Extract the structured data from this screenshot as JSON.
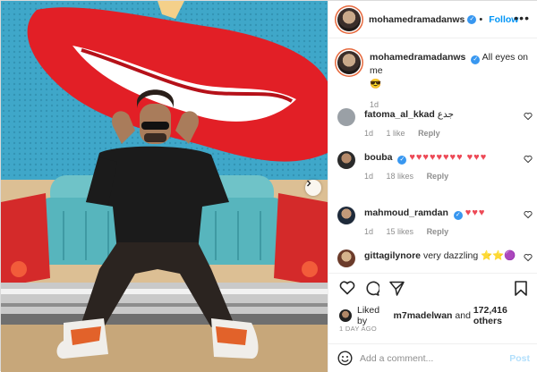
{
  "post": {
    "author": "mohamedramadanws",
    "follow_label": "Follow",
    "more_label": "•••"
  },
  "caption": {
    "username": "mohamedramadanws",
    "text": "All eyes on me",
    "emoji": "😎",
    "age": "1d"
  },
  "comments": [
    {
      "username": "fatoma_al_kkad",
      "verified": false,
      "text": "جدع",
      "age": "1d",
      "likes": "1 like",
      "reply_label": "Reply"
    },
    {
      "username": "bouba",
      "verified": true,
      "text": "♥♥♥♥♥♥♥♥ ♥♥♥",
      "age": "1d",
      "likes": "18 likes",
      "reply_label": "Reply"
    },
    {
      "username": "mahmoud_ramdan",
      "verified": true,
      "text": "♥♥♥",
      "age": "1d",
      "likes": "15 likes",
      "reply_label": "Reply"
    },
    {
      "username": "gittagilynore",
      "verified": false,
      "text": "very dazzling",
      "emoji": "⭐⭐🟣",
      "age": "",
      "likes": "",
      "reply_label": ""
    }
  ],
  "likes": {
    "prefix": "Liked by",
    "first_user": "m7madelwan",
    "middle": "and",
    "others": "172,416 others"
  },
  "timestamp": "1 DAY AGO",
  "add_comment": {
    "placeholder": "Add a comment...",
    "post_label": "Post",
    "emoji_icon": "smile-icon"
  },
  "colors": {
    "accent": "#0095f6",
    "heart": "#ed4956",
    "muted": "#8e8e8e",
    "post_disabled": "#b2dffc"
  }
}
